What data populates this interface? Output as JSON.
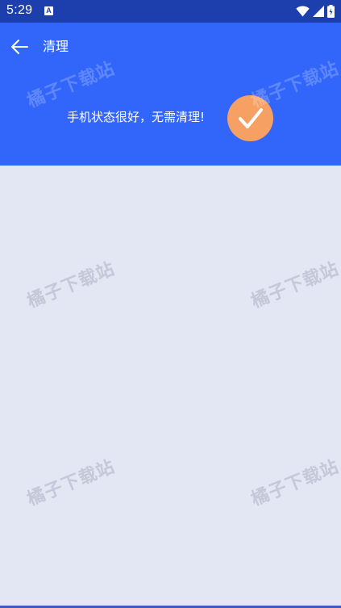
{
  "status_bar": {
    "time": "5:29",
    "notification_icon": "a-letter-icon",
    "icons": [
      "wifi-icon",
      "cell-signal-icon",
      "battery-icon"
    ]
  },
  "app_bar": {
    "title": "清理",
    "back_icon": "arrow-left-icon"
  },
  "header": {
    "message": "手机状态很好，无需清理!",
    "badge_icon": "checkmark-icon"
  },
  "watermark": {
    "text": "橘子下载站"
  },
  "colors": {
    "status_bar": "#1c3fad",
    "app_bar": "#3266fb",
    "content_bg": "#e3e6f3",
    "badge": "#f6a163"
  }
}
